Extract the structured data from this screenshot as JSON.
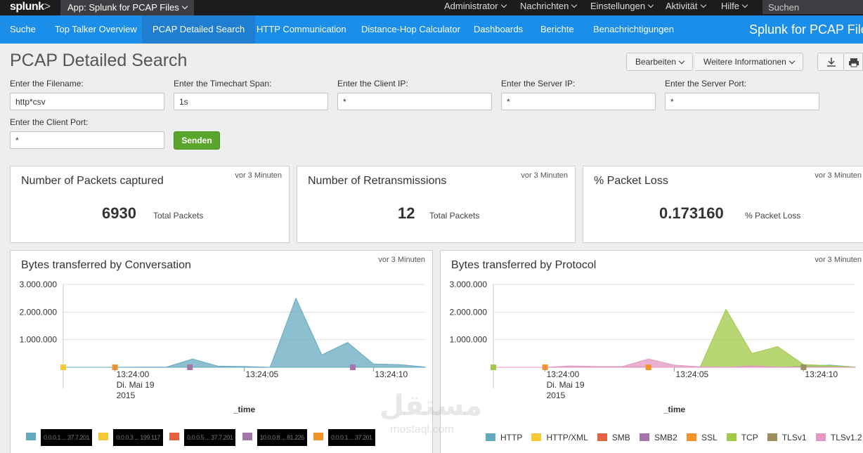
{
  "sysbar": {
    "logo": "splunk",
    "logo_suffix": ">",
    "app_menu": "App: Splunk for PCAP Files",
    "menus": [
      "Administrator",
      "Nachrichten",
      "Einstellungen",
      "Aktivität",
      "Hilfe"
    ],
    "search_placeholder": "Suchen"
  },
  "appnav": {
    "items": [
      "Suche",
      "Top Talker Overview",
      "PCAP Detailed Search",
      "HTTP Communication",
      "Distance-Hop Calculator",
      "Dashboards",
      "Berichte",
      "Benachrichtigungen"
    ],
    "active": "PCAP Detailed Search",
    "app_title": "Splunk for PCAP Files"
  },
  "page": {
    "title": "PCAP Detailed Search",
    "edit_label": "Bearbeiten",
    "more_info_label": "Weitere Informationen",
    "download_icon": "download-icon",
    "print_icon": "print-icon"
  },
  "form": {
    "filename": {
      "label": "Enter the Filename:",
      "value": "http*csv"
    },
    "span": {
      "label": "Enter the Timechart Span:",
      "value": "1s"
    },
    "client_ip": {
      "label": "Enter the Client IP:",
      "value": "*"
    },
    "server_ip": {
      "label": "Enter the Server IP:",
      "value": "*"
    },
    "server_port": {
      "label": "Enter the Server Port:",
      "value": "*"
    },
    "client_port": {
      "label": "Enter the Client Port:",
      "value": "*"
    },
    "submit_label": "Senden"
  },
  "stats": [
    {
      "title": "Number of Packets captured",
      "time": "vor 3 Minuten",
      "value": "6930",
      "unit": "Total Packets"
    },
    {
      "title": "Number of Retransmissions",
      "time": "vor 3 Minuten",
      "value": "12",
      "unit": "Total Packets"
    },
    {
      "title": "% Packet Loss",
      "time": "vor 3 Minuten",
      "value": "0.173160",
      "unit": "% Packet Loss"
    }
  ],
  "charts": {
    "conversation": {
      "title": "Bytes transferred by Conversation",
      "time": "vor 3 Minuten"
    },
    "protocol": {
      "title": "Bytes transferred by Protocol",
      "time": "vor 3 Minuten"
    }
  },
  "chart_data": [
    {
      "type": "area",
      "title": "Bytes transferred by Conversation",
      "xlabel": "_time",
      "ylabel": "",
      "ylim": [
        0,
        3000000
      ],
      "yticks": [
        "1.000.000",
        "2.000.000",
        "3.000.000"
      ],
      "xticks": [
        {
          "t": 0,
          "lines": [
            "13:24:00",
            "Di. Mai 19",
            "2015"
          ]
        },
        {
          "t": 5,
          "lines": [
            "13:24:05"
          ]
        },
        {
          "t": 10,
          "lines": [
            "13:24:10"
          ]
        }
      ],
      "x": [
        -2,
        -1,
        0,
        1,
        2,
        3,
        4,
        5,
        6,
        7,
        8,
        9,
        10,
        11,
        12
      ],
      "series": [
        {
          "name": "0.0.0.1 ... 37.7.201",
          "color": "#65a9bf",
          "values": [
            0,
            0,
            0,
            10000,
            10000,
            300000,
            40000,
            30000,
            0,
            2500000,
            450000,
            900000,
            120000,
            100000,
            10000
          ]
        },
        {
          "name": "0.0.0.3 ... 199.117",
          "color": "#f5c936",
          "values": [
            0,
            0,
            0,
            0,
            0,
            0,
            0,
            0,
            0,
            0,
            0,
            0,
            0,
            0,
            0
          ]
        },
        {
          "name": "0.0.0.5 ... 37.7.201",
          "color": "#e4623f",
          "values": [
            0,
            0,
            0,
            0,
            0,
            0,
            0,
            0,
            0,
            0,
            0,
            0,
            0,
            0,
            0
          ]
        },
        {
          "name": "10.0.0.8 ... 81.226",
          "color": "#a575a9",
          "values": [
            0,
            0,
            0,
            0,
            0,
            0,
            0,
            0,
            0,
            0,
            0,
            0,
            0,
            0,
            0
          ]
        },
        {
          "name": "0.0.0.1 ... 37.201",
          "color": "#f39329",
          "values": [
            0,
            0,
            0,
            0,
            0,
            0,
            0,
            0,
            0,
            0,
            0,
            0,
            0,
            0,
            0
          ]
        }
      ],
      "legend_placement": "bottom"
    },
    {
      "type": "area",
      "title": "Bytes transferred by Protocol",
      "xlabel": "_time",
      "ylabel": "",
      "ylim": [
        0,
        3000000
      ],
      "yticks": [
        "1.000.000",
        "2.000.000",
        "3.000.000"
      ],
      "xticks": [
        {
          "t": 0,
          "lines": [
            "13:24:00",
            "Di. Mai 19",
            "2015"
          ]
        },
        {
          "t": 5,
          "lines": [
            "13:24:05"
          ]
        },
        {
          "t": 10,
          "lines": [
            "13:24:10"
          ]
        }
      ],
      "x": [
        -2,
        -1,
        0,
        1,
        2,
        3,
        4,
        5,
        6,
        7,
        8,
        9,
        10,
        11,
        12
      ],
      "series": [
        {
          "name": "HTTP",
          "color": "#65a9bf",
          "values": [
            0,
            0,
            0,
            0,
            0,
            0,
            0,
            0,
            0,
            0,
            0,
            0,
            40000,
            80000,
            10000
          ]
        },
        {
          "name": "HTTP/XML",
          "color": "#f5c936",
          "values": [
            0,
            0,
            0,
            0,
            0,
            0,
            0,
            0,
            0,
            0,
            0,
            0,
            0,
            0,
            0
          ]
        },
        {
          "name": "SMB",
          "color": "#e4623f",
          "values": [
            0,
            0,
            0,
            0,
            0,
            0,
            0,
            0,
            0,
            0,
            0,
            0,
            0,
            0,
            0
          ]
        },
        {
          "name": "SMB2",
          "color": "#a575a9",
          "values": [
            0,
            0,
            0,
            0,
            0,
            0,
            0,
            0,
            0,
            0,
            0,
            0,
            0,
            0,
            0
          ]
        },
        {
          "name": "SSL",
          "color": "#f39329",
          "values": [
            0,
            0,
            0,
            0,
            0,
            0,
            0,
            0,
            0,
            0,
            0,
            0,
            0,
            0,
            0
          ]
        },
        {
          "name": "TCP",
          "color": "#a0c946",
          "values": [
            0,
            0,
            0,
            10000,
            10000,
            20000,
            10000,
            0,
            10000,
            2100000,
            500000,
            750000,
            100000,
            60000,
            10000
          ]
        },
        {
          "name": "TLSv1",
          "color": "#9d8e5e",
          "values": [
            0,
            0,
            0,
            0,
            0,
            0,
            0,
            0,
            0,
            0,
            0,
            0,
            0,
            0,
            0
          ]
        },
        {
          "name": "TLSv1.2",
          "color": "#e397c4",
          "values": [
            0,
            0,
            0,
            50000,
            30000,
            30000,
            300000,
            80000,
            20000,
            0,
            50000,
            10000,
            0,
            0,
            0
          ]
        }
      ],
      "legend_placement": "bottom"
    }
  ],
  "watermark": {
    "main": "مستقل",
    "sub": "mostaql.com"
  }
}
